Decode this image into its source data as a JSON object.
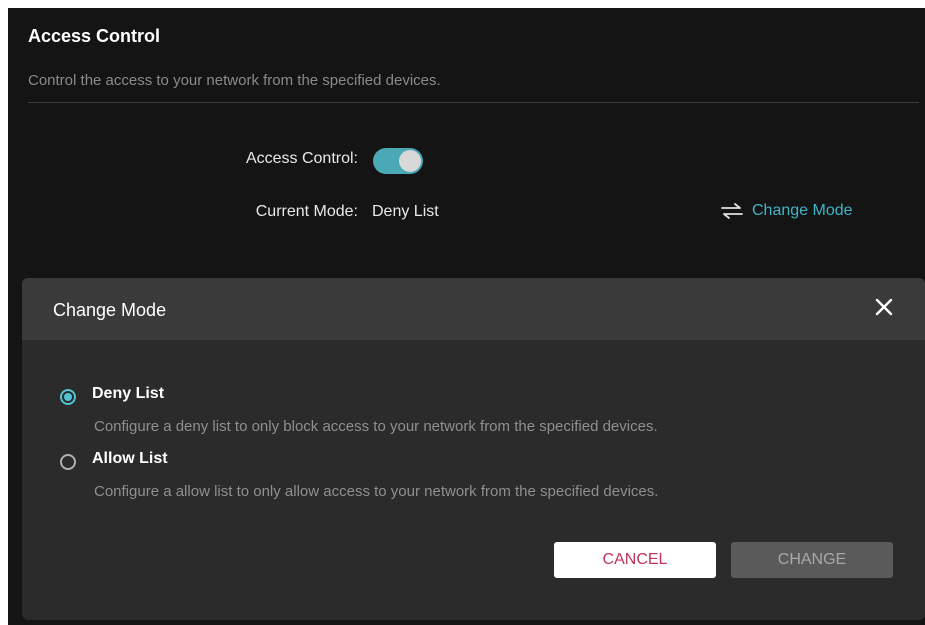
{
  "section": {
    "title": "Access Control",
    "description": "Control the access to your network from the specified devices."
  },
  "settings": {
    "access_control_label": "Access Control:",
    "access_control_enabled": true,
    "current_mode_label": "Current Mode:",
    "current_mode_value": "Deny List",
    "change_mode_link": "Change Mode",
    "change_mode_icon": "swap-arrows-icon"
  },
  "modal": {
    "title": "Change Mode",
    "close_icon": "close-icon",
    "options": [
      {
        "label": "Deny List",
        "description": "Configure a deny list to only block access to your network from the specified devices.",
        "selected": true
      },
      {
        "label": "Allow List",
        "description": "Configure a allow list to only allow access to your network from the specified devices.",
        "selected": false
      }
    ],
    "cancel_label": "CANCEL",
    "change_label": "CHANGE"
  },
  "colors": {
    "accent": "#3fb5c6",
    "toggle_on": "#4aa9b5",
    "cancel_text": "#c0335a",
    "background": "#141414",
    "modal_background": "#2b2b2b"
  }
}
